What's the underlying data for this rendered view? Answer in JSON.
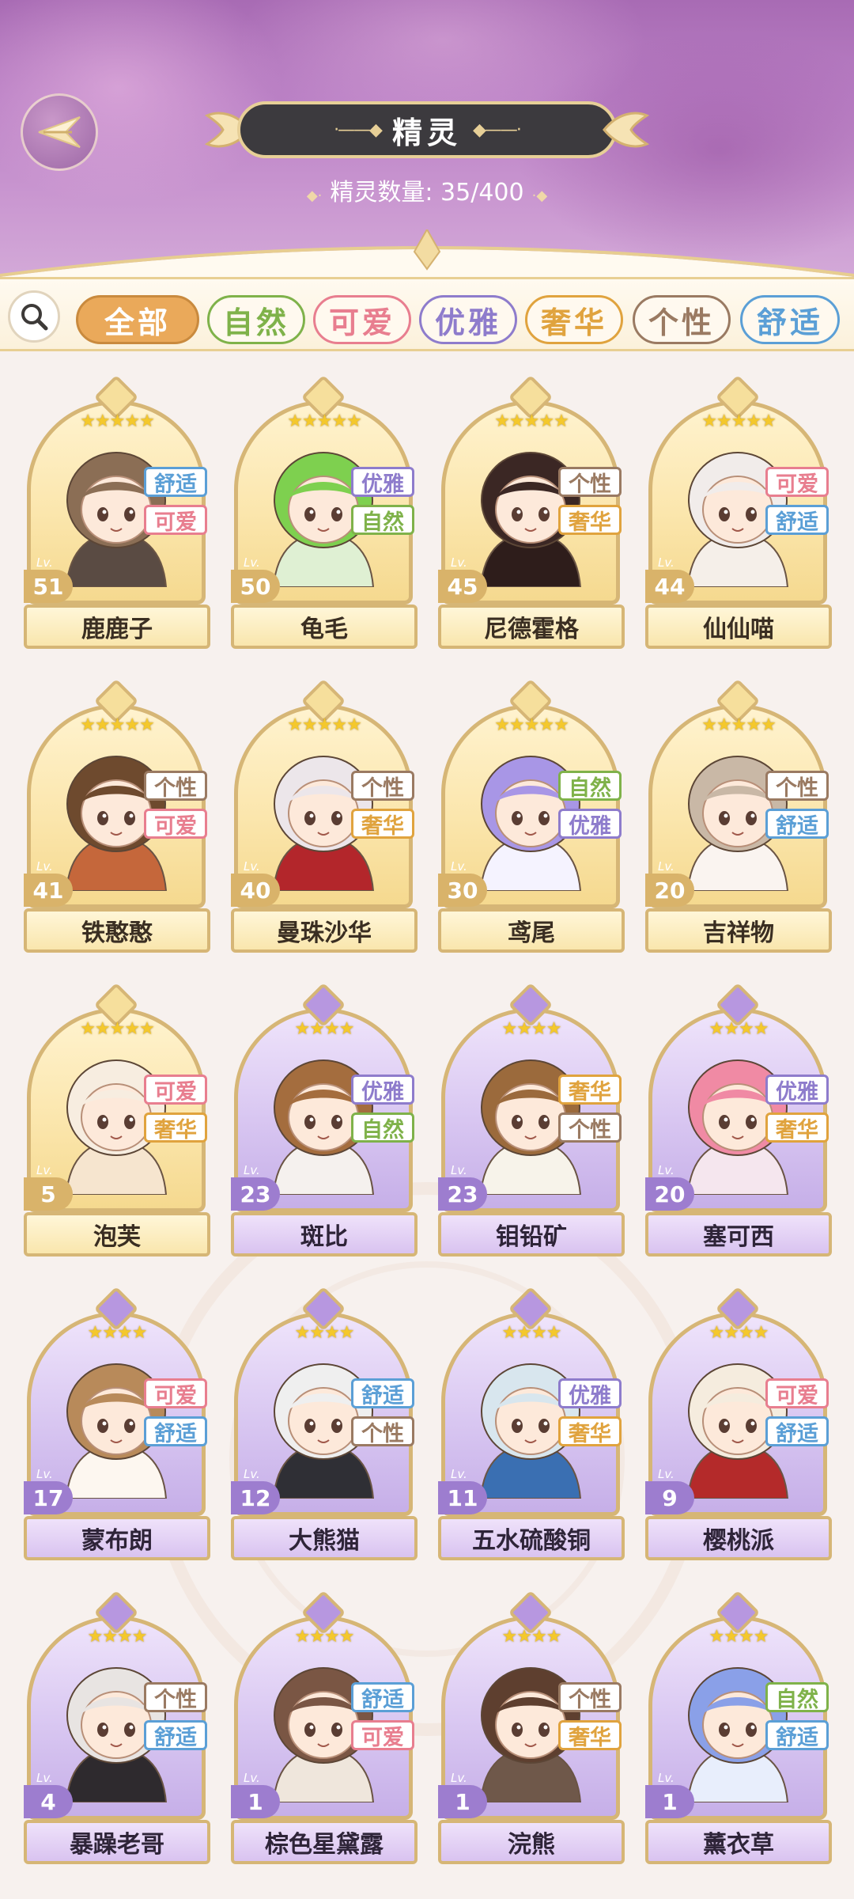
{
  "header": {
    "title": "精灵",
    "count_label": "精灵数量: 35/400",
    "back_icon": "wing-back-icon"
  },
  "filter": {
    "search_icon": "search-icon",
    "chips": [
      {
        "label": "全部",
        "selected": true
      },
      {
        "label": "自然"
      },
      {
        "label": "可爱"
      },
      {
        "label": "优雅"
      },
      {
        "label": "奢华"
      },
      {
        "label": "个性"
      },
      {
        "label": "舒适"
      }
    ]
  },
  "colors": {
    "自然": "#7fb24a",
    "可爱": "#e87e8f",
    "优雅": "#8e7ccc",
    "奢华": "#e0a33e",
    "个性": "#9a7a62",
    "舒适": "#5b9fd6",
    "全部": "#e5a44e"
  },
  "sprites": [
    {
      "name": "鹿鹿子",
      "level": "51",
      "stars": "★★★★★",
      "tags": [
        "舒适",
        "可爱"
      ],
      "rarity": "gold"
    },
    {
      "name": "龟毛",
      "level": "50",
      "stars": "★★★★★",
      "tags": [
        "优雅",
        "自然"
      ],
      "rarity": "gold"
    },
    {
      "name": "尼德霍格",
      "level": "45",
      "stars": "★★★★★",
      "tags": [
        "个性",
        "奢华"
      ],
      "rarity": "gold"
    },
    {
      "name": "仙仙喵",
      "level": "44",
      "stars": "★★★★★",
      "tags": [
        "可爱",
        "舒适"
      ],
      "rarity": "gold"
    },
    {
      "name": "铁憨憨",
      "level": "41",
      "stars": "★★★★★",
      "tags": [
        "个性",
        "可爱"
      ],
      "rarity": "gold"
    },
    {
      "name": "曼珠沙华",
      "level": "40",
      "stars": "★★★★★",
      "tags": [
        "个性",
        "奢华"
      ],
      "rarity": "gold"
    },
    {
      "name": "鸢尾",
      "level": "30",
      "stars": "★★★★★",
      "tags": [
        "自然",
        "优雅"
      ],
      "rarity": "gold"
    },
    {
      "name": "吉祥物",
      "level": "20",
      "stars": "★★★★★",
      "tags": [
        "个性",
        "舒适"
      ],
      "rarity": "gold"
    },
    {
      "name": "泡芙",
      "level": "5",
      "stars": "★★★★★",
      "tags": [
        "可爱",
        "奢华"
      ],
      "rarity": "gold"
    },
    {
      "name": "斑比",
      "level": "23",
      "stars": "★★★★",
      "tags": [
        "优雅",
        "自然"
      ],
      "rarity": "purple"
    },
    {
      "name": "钼铅矿",
      "level": "23",
      "stars": "★★★★",
      "tags": [
        "奢华",
        "个性"
      ],
      "rarity": "purple"
    },
    {
      "name": "塞可西",
      "level": "20",
      "stars": "★★★★",
      "tags": [
        "优雅",
        "奢华"
      ],
      "rarity": "purple"
    },
    {
      "name": "蒙布朗",
      "level": "17",
      "stars": "★★★★",
      "tags": [
        "可爱",
        "舒适"
      ],
      "rarity": "purple"
    },
    {
      "name": "大熊猫",
      "level": "12",
      "stars": "★★★★",
      "tags": [
        "舒适",
        "个性"
      ],
      "rarity": "purple"
    },
    {
      "name": "五水硫酸铜",
      "level": "11",
      "stars": "★★★★",
      "tags": [
        "优雅",
        "奢华"
      ],
      "rarity": "purple"
    },
    {
      "name": "樱桃派",
      "level": "9",
      "stars": "★★★★",
      "tags": [
        "可爱",
        "舒适"
      ],
      "rarity": "purple"
    },
    {
      "name": "暴躁老哥",
      "level": "4",
      "stars": "★★★★",
      "tags": [
        "个性",
        "舒适"
      ],
      "rarity": "purple"
    },
    {
      "name": "棕色星黛露",
      "level": "1",
      "stars": "★★★★",
      "tags": [
        "舒适",
        "可爱"
      ],
      "rarity": "purple"
    },
    {
      "name": "浣熊",
      "level": "1",
      "stars": "★★★★",
      "tags": [
        "个性",
        "奢华"
      ],
      "rarity": "purple"
    },
    {
      "name": "薰衣草",
      "level": "1",
      "stars": "★★★★",
      "tags": [
        "自然",
        "舒适"
      ],
      "rarity": "purple"
    }
  ],
  "lv_prefix": "Lv."
}
